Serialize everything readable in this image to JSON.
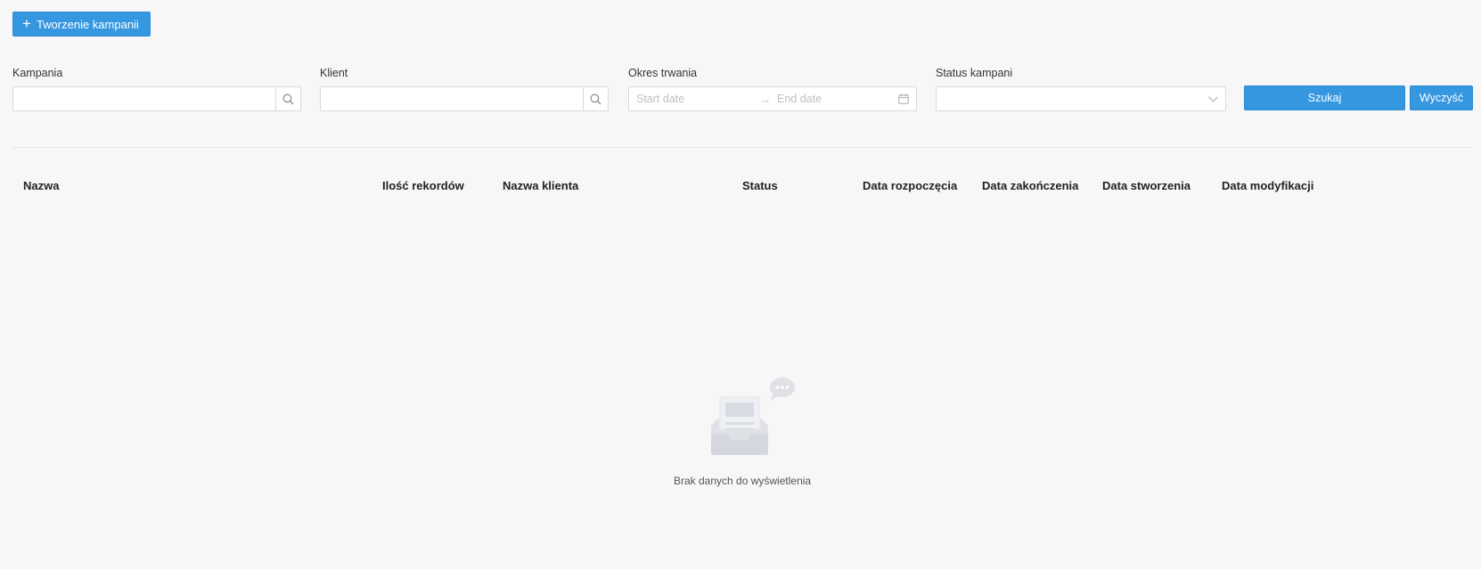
{
  "toolbar": {
    "create_label": "Tworzenie kampanii"
  },
  "filters": {
    "campaign": {
      "label": "Kampania",
      "value": ""
    },
    "client": {
      "label": "Klient",
      "value": ""
    },
    "period": {
      "label": "Okres trwania",
      "start_placeholder": "Start date",
      "end_placeholder": "End date"
    },
    "status": {
      "label": "Status kampani",
      "value": ""
    }
  },
  "actions": {
    "search_label": "Szukaj",
    "clear_label": "Wyczyść"
  },
  "table": {
    "columns": [
      "Nazwa",
      "Ilość rekordów",
      "Nazwa klienta",
      "Status",
      "Data rozpoczęcia",
      "Data zakończenia",
      "Data stworzenia",
      "Data modyfikacji"
    ],
    "empty_text": "Brak danych do wyświetlenia"
  },
  "icons": {
    "create": "plus-icon",
    "search": "search-icon",
    "calendar": "calendar-icon",
    "dropdown": "chevron-down-icon",
    "empty": "empty-inbox-icon"
  },
  "colors": {
    "primary": "#3497e0",
    "background": "#f7f7f7"
  }
}
